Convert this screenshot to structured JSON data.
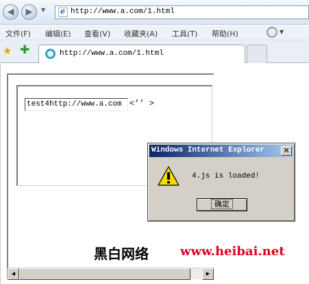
{
  "browser": {
    "address_url": "http://www.a.com/1.html",
    "menu": [
      {
        "label": "文件(F)"
      },
      {
        "label": "编辑(E)"
      },
      {
        "label": "查看(V)"
      },
      {
        "label": "收藏夹(A)"
      },
      {
        "label": "工具(T)"
      },
      {
        "label": "帮助(H)"
      }
    ],
    "tab_title": "http://www.a.com/1.html",
    "icons": {
      "back": "back-arrow-icon",
      "forward": "forward-arrow-icon",
      "favorites": "star-icon",
      "add_favorite": "add-favorite-icon",
      "tools": "gear-icon"
    }
  },
  "page": {
    "input_value": "test4http://www.a.com",
    "after_input_text": "<’’ >"
  },
  "dialog": {
    "title": "Windows Internet Explorer",
    "message": "4.js is loaded!",
    "ok_label": "确定",
    "close_glyph": "✕",
    "icon": "warning-icon",
    "title_gradient_start": "#0a246a",
    "title_gradient_end": "#a6caf0"
  },
  "watermark": {
    "text_cn": "黑白网络",
    "url": "www.heibai.net",
    "url_color": "#e0001a"
  }
}
